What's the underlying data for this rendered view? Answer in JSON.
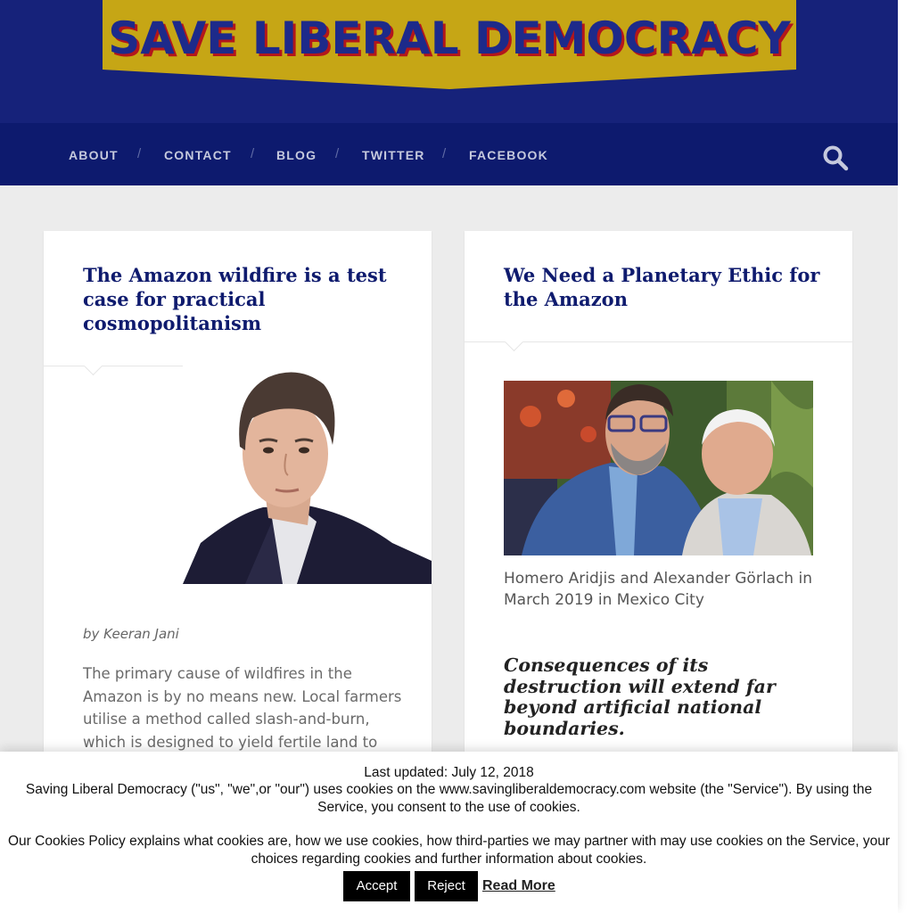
{
  "site": {
    "logo_text": "SAVE LIBERAL DEMOCRACY",
    "colors": {
      "header": "#16227a",
      "nav": "#0d1a6e",
      "banner": "#c6a615",
      "title": "#0f1b6e",
      "shadow_red": "#b3161b"
    }
  },
  "nav": {
    "items": [
      {
        "label": "ABOUT"
      },
      {
        "label": "CONTACT"
      },
      {
        "label": "BLOG"
      },
      {
        "label": "TWITTER"
      },
      {
        "label": "FACEBOOK"
      }
    ],
    "separator": "/",
    "search_icon": "search-icon"
  },
  "posts": [
    {
      "title": "The Amazon wildfire is a test case for practical cosmopolitanism",
      "byline": "by Keeran Jani",
      "excerpt": "The primary cause of wildfires in the Amazon is by no means new. Local farmers utilise a method called slash-and-burn, which is designed to yield fertile land to"
    },
    {
      "title": "We Need a Planetary Ethic for the Amazon",
      "caption": "Homero Aridjis and Alexander Görlach in March 2019 in Mexico City",
      "pull_quote": "Consequences of its destruction will extend far beyond artificial national boundaries."
    }
  ],
  "cookie": {
    "updated": "Last updated: July 12, 2018",
    "paragraph1": "Saving Liberal Democracy (\"us\", \"we\",or \"our\") uses cookies on the www.savingliberaldemocracy.com website (the \"Service\"). By using the Service, you consent to the use of cookies.",
    "paragraph2": "Our Cookies Policy explains what cookies are, how we use cookies, how third-parties we may partner with may use cookies on the Service, your choices regarding cookies and further information about cookies.",
    "accept_label": "Accept",
    "reject_label": "Reject",
    "read_more_label": "Read More"
  }
}
